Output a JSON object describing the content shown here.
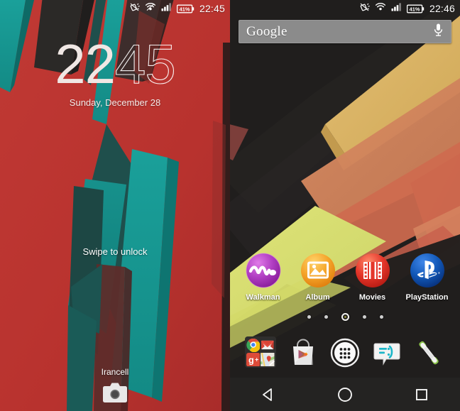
{
  "lockscreen": {
    "statusbar": {
      "icons": [
        "vibrate-icon",
        "wifi-icon",
        "signal-icon"
      ],
      "battery_percent": "41%",
      "time": "22:45"
    },
    "clock": {
      "hours": "22",
      "minutes": "45",
      "date": "Sunday, December 28"
    },
    "hint": "Swipe to unlock",
    "carrier": "Irancell",
    "camera_shortcut": "camera-icon",
    "wallpaper": {
      "base_color": "#b9322f",
      "accent_teal": "#18918c",
      "accent_dark_teal": "#1d4a47",
      "accent_dark": "#2c2a28",
      "accent_maroon": "#5c2a28"
    }
  },
  "homescreen": {
    "statusbar": {
      "icons": [
        "vibrate-icon",
        "wifi-icon",
        "signal-icon"
      ],
      "battery_percent": "41%",
      "time": "22:46"
    },
    "search": {
      "logo": "Google",
      "placeholder": "Google",
      "voice_icon": "microphone-icon"
    },
    "apps": [
      {
        "label": "Walkman",
        "icon": "walkman-icon",
        "color": "#b641c8"
      },
      {
        "label": "Album",
        "icon": "album-icon",
        "color": "#f0a22b"
      },
      {
        "label": "Movies",
        "icon": "movies-icon",
        "color": "#e2392b"
      },
      {
        "label": "PlayStation",
        "icon": "playstation-icon",
        "color": "#1257b5"
      }
    ],
    "page_indicator": {
      "count": 5,
      "active_index": 2
    },
    "dock": [
      {
        "label": "Google",
        "icon": "google-folder-icon"
      },
      {
        "label": "Play Store",
        "icon": "play-store-icon"
      },
      {
        "label": "Apps",
        "icon": "app-drawer-icon"
      },
      {
        "label": "Messaging",
        "icon": "messaging-icon"
      },
      {
        "label": "Phone",
        "icon": "phone-icon"
      }
    ],
    "folder_apps": [
      "chrome-icon",
      "gmail-icon",
      "google-plus-icon",
      "maps-icon"
    ],
    "navbar": [
      {
        "label": "Back",
        "icon": "back-triangle-icon"
      },
      {
        "label": "Home",
        "icon": "home-circle-icon"
      },
      {
        "label": "Recents",
        "icon": "recents-square-icon"
      }
    ],
    "wallpaper": {
      "base_color": "#211f1e",
      "band_gold": "#dcb567",
      "band_salmon": "#d4835c",
      "band_red": "#b5453f",
      "band_lime": "#d6dc70",
      "band_orange": "#cf6a4f"
    }
  }
}
